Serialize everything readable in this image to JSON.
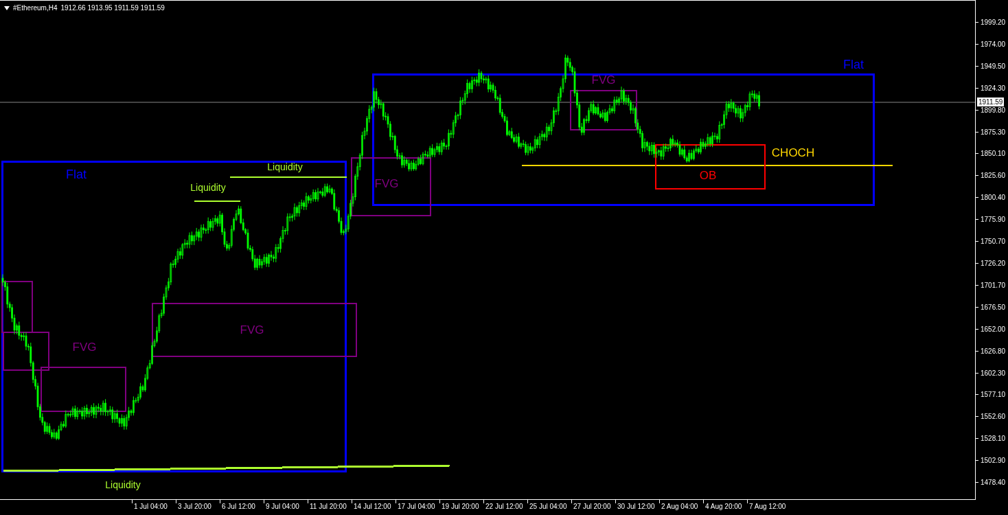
{
  "chart": {
    "symbol": "#Ethereum,H4",
    "ohlc": "1912.66 1913.95 1911.59 1911.59",
    "current_price": "1911.59",
    "price_ticks": [
      "1999.20",
      "1974.00",
      "1949.50",
      "1924.30",
      "1899.80",
      "1875.30",
      "1850.10",
      "1825.60",
      "1800.40",
      "1775.90",
      "1750.70",
      "1726.20",
      "1701.70",
      "1676.50",
      "1652.00",
      "1626.80",
      "1602.30",
      "1577.10",
      "1552.60",
      "1528.10",
      "1502.90",
      "1478.40"
    ],
    "time_ticks": [
      "1 Jul 04:00",
      "3 Jul 20:00",
      "6 Jul 12:00",
      "9 Jul 04:00",
      "11 Jul 20:00",
      "14 Jul 12:00",
      "17 Jul 04:00",
      "19 Jul 20:00",
      "22 Jul 12:00",
      "25 Jul 04:00",
      "27 Jul 20:00",
      "30 Jul 12:00",
      "2 Aug 04:00",
      "4 Aug 20:00",
      "7 Aug 12:00"
    ],
    "annotations": [
      {
        "kind": "box",
        "label": "Flat",
        "color": "#0000ff"
      },
      {
        "kind": "box",
        "label": "Flat",
        "color": "#0000ff"
      },
      {
        "kind": "box",
        "color": "#800080"
      },
      {
        "kind": "box",
        "color": "#800080"
      },
      {
        "kind": "box",
        "label": "FVG",
        "color": "#800080"
      },
      {
        "kind": "box",
        "label": "FVG",
        "color": "#800080"
      },
      {
        "kind": "box",
        "label": "FVG",
        "color": "#800080"
      },
      {
        "kind": "box",
        "label": "FVG",
        "color": "#800080"
      },
      {
        "kind": "line",
        "label": "Liquidity",
        "color": "#adff2f"
      },
      {
        "kind": "line",
        "label": "Liquidity",
        "color": "#adff2f"
      },
      {
        "kind": "line",
        "label": "Liquidity",
        "color": "#adff2f"
      },
      {
        "kind": "line",
        "label": "CHOCH",
        "color": "#ffd700"
      },
      {
        "kind": "box",
        "label": "OB",
        "color": "#ff0000"
      }
    ]
  }
}
